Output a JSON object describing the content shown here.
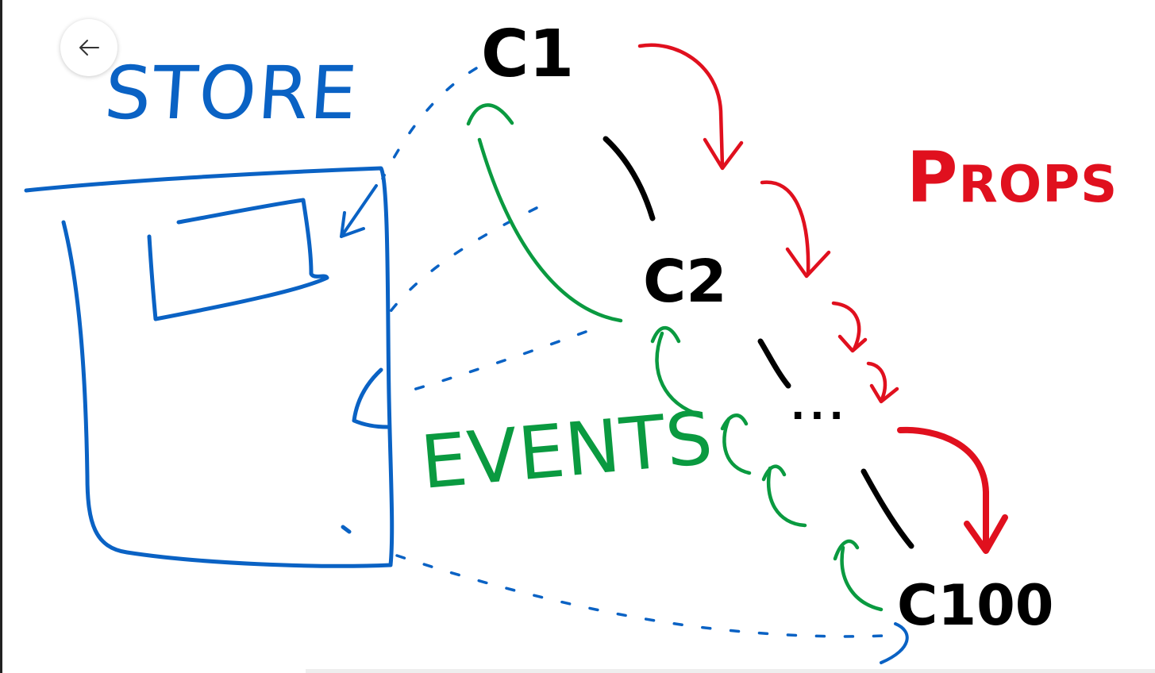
{
  "colors": {
    "store": "#0a62c4",
    "props": "#e0101e",
    "events": "#0a9a40",
    "nodes": "#000000"
  },
  "back_button": {
    "icon": "arrow-left-icon"
  },
  "labels": {
    "store": "STORE",
    "props_first": "P",
    "props_rest": "ROPS",
    "events": "EVENTS"
  },
  "nodes": {
    "c1": "C1",
    "c2": "C2",
    "ellipsis": "...",
    "c100": "C100"
  }
}
